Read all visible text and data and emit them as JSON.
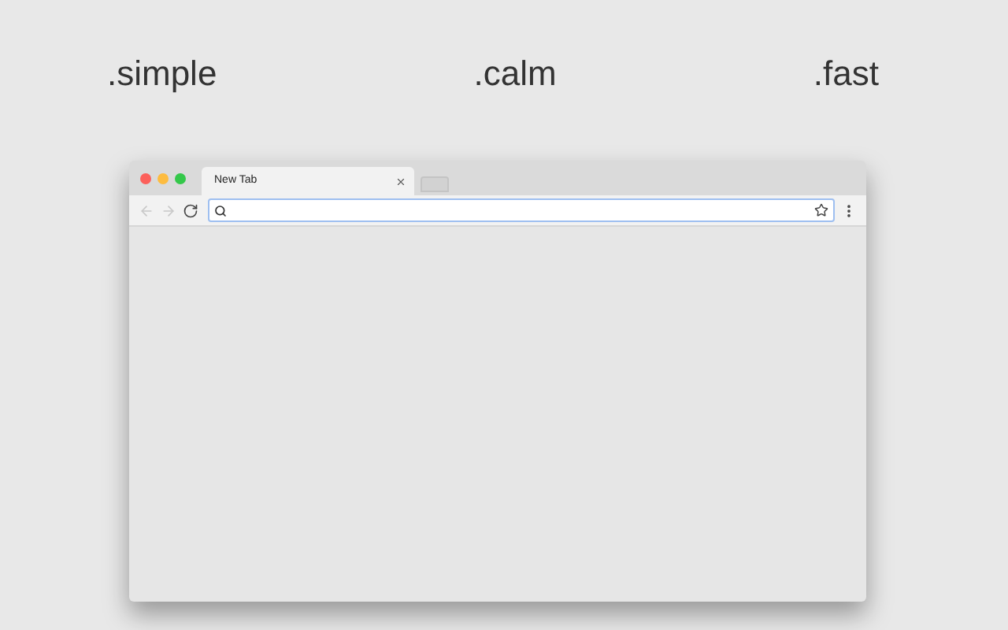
{
  "taglines": [
    ".simple",
    ".calm",
    ".fast"
  ],
  "browser": {
    "tabs": [
      {
        "title": "New Tab",
        "selected": true
      },
      {
        "selected": false
      }
    ],
    "nav_buttons": [
      {
        "kind": "back",
        "disabled": true
      },
      {
        "kind": "forward",
        "disabled": true
      },
      {
        "kind": "reload",
        "disabled": false
      }
    ]
  }
}
